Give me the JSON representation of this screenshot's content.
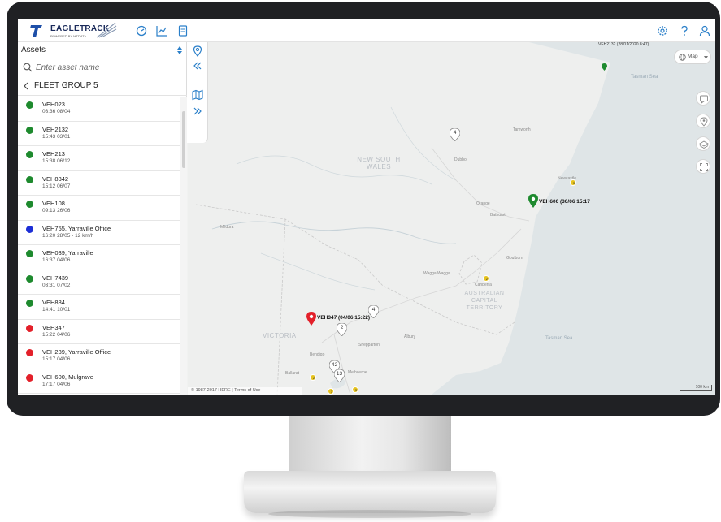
{
  "app": {
    "brand": "EAGLETRACK",
    "brand_sub": "POWERED BY MTDATA"
  },
  "sidebar": {
    "title": "Assets",
    "search_placeholder": "Enter asset name",
    "group": "FLEET GROUP 5",
    "items": [
      {
        "name": "VEH023",
        "time": "03:36 08/04",
        "status": "green"
      },
      {
        "name": "VEH2132",
        "time": "15:43 03/01",
        "status": "green"
      },
      {
        "name": "VEH213",
        "time": "15:38 06/12",
        "status": "green"
      },
      {
        "name": "VEH8342",
        "time": "15:12 06/07",
        "status": "green"
      },
      {
        "name": "VEH108",
        "time": "09:13 26/06",
        "status": "green"
      },
      {
        "name": "VEH755, Yarraville Office",
        "time": "16:20 28/05 - 12 km/h",
        "status": "blue"
      },
      {
        "name": "VEH039, Yarraville",
        "time": "16:37 04/06",
        "status": "green"
      },
      {
        "name": "VEH7439",
        "time": "03:31 07/02",
        "status": "green"
      },
      {
        "name": "VEH884",
        "time": "14:41 10/01",
        "status": "green"
      },
      {
        "name": "VEH347",
        "time": "15:22 04/06",
        "status": "red"
      },
      {
        "name": "VEH239, Yarraville Office",
        "time": "15:17 04/06",
        "status": "red"
      },
      {
        "name": "VEH600, Mulgrave",
        "time": "17:17 04/06",
        "status": "red"
      }
    ]
  },
  "colors": {
    "green": "#1e8a2e",
    "blue": "#1d2fd6",
    "red": "#e3202a",
    "accent": "#2a7fc9",
    "yellow": "#e6c31f"
  },
  "map": {
    "type_label": "Map",
    "regions": {
      "nsw": "NEW SOUTH WALES",
      "victoria": "VICTORIA",
      "act": "AUSTRALIAN CAPITAL TERRITORY"
    },
    "seas": {
      "tasman_1": "Tasman Sea",
      "tasman_2": "Tasman Sea"
    },
    "places": {
      "dubbo": "Dubbo",
      "orange": "Orange",
      "bathurst": "Bathurst",
      "canberra": "Canberra",
      "wagga": "Wagga Wagga",
      "bendigo": "Bendigo",
      "melbourne": "Melbourne",
      "newcastle": "Newcastle",
      "tamworth": "Tamworth",
      "goulburn": "Goulburn",
      "mildura": "Mildura",
      "albury": "Albury",
      "shepparton": "Shepparton",
      "ballarat": "Ballarat"
    },
    "pins": {
      "red_label": "VEH347 (04/06 15:22)",
      "green_label": "VEH600 (30/06 15:17",
      "top_label": "VEH2132 (28/01/2020 8:47)"
    },
    "clusters": [
      "4",
      "4",
      "2",
      "42",
      "13"
    ],
    "ycluster_labels": [
      "3",
      "2",
      "2",
      "3",
      "3"
    ],
    "attribution": "© 1987-2017 HERE | Terms of Use",
    "scale": "100 km"
  },
  "icons": {
    "map_type": "globe-icon",
    "map_tools": [
      "chat-icon",
      "location-icon",
      "layers-icon",
      "fullscreen-icon"
    ],
    "topnav": [
      "dashboard-icon",
      "chart-icon",
      "report-icon"
    ],
    "topright": [
      "settings-icon",
      "help-icon",
      "user-icon"
    ],
    "tabs": [
      "location-pin-icon",
      "collapse-left-icon",
      "map-icon",
      "expand-right-icon"
    ]
  }
}
